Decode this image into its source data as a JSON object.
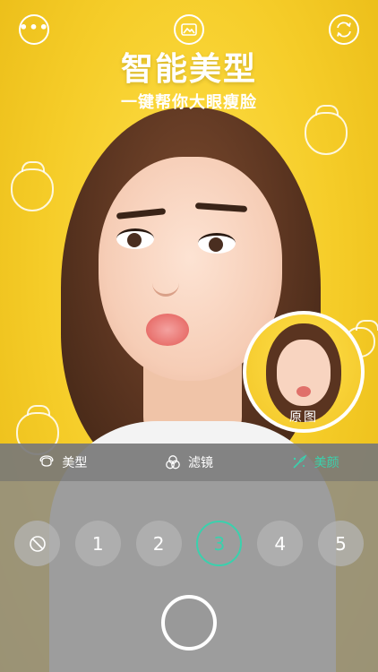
{
  "header": {
    "more_icon": "more-dots-icon",
    "gallery_icon": "gallery-icon",
    "switch_camera_icon": "switch-camera-icon",
    "headline": "智能美型",
    "subline": "一键帮你大眼瘦脸"
  },
  "thumbnail": {
    "label": "原图"
  },
  "tabs": [
    {
      "label": "美型",
      "icon": "face-outline-icon",
      "active": false
    },
    {
      "label": "滤镜",
      "icon": "filter-circles-icon",
      "active": false
    },
    {
      "label": "美颜",
      "icon": "beauty-brush-icon",
      "active": true
    }
  ],
  "levels": {
    "off_icon": "no-effect-icon",
    "values": [
      "1",
      "2",
      "3",
      "4",
      "5"
    ],
    "selected": "3"
  },
  "colors": {
    "accent": "#3ad1ad",
    "background": "#f4cf2c"
  }
}
